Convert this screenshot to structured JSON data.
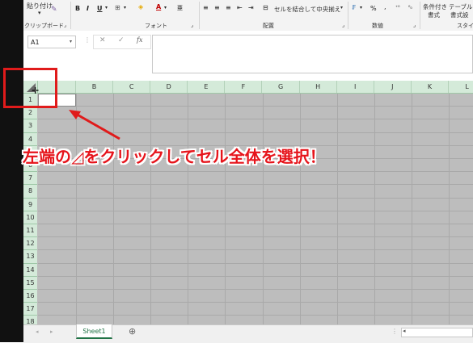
{
  "ribbon": {
    "paste_label": "貼り付け",
    "bold": "B",
    "italic": "I",
    "underline": "U",
    "merge_center_label": "セルを結合して中央揃え",
    "percent": "%",
    "comma": ",",
    "conditional_format_line1": "条件付き",
    "conditional_format_line2": "書式",
    "table_format_line1": "テーブル",
    "table_format_line2": "書式設",
    "groups": {
      "clipboard": "クリップボード",
      "font": "フォント",
      "alignment": "配置",
      "number": "数値",
      "styles": "スタイ"
    }
  },
  "formula_bar": {
    "name_box": "A1",
    "fx": "fx"
  },
  "columns": [
    "B",
    "C",
    "D",
    "E",
    "F",
    "G",
    "H",
    "I",
    "J",
    "K",
    "L"
  ],
  "rows": [
    "1",
    "2",
    "3",
    "4",
    "5",
    "6",
    "7",
    "8",
    "9",
    "10",
    "11",
    "12",
    "13",
    "14",
    "15",
    "16",
    "17",
    "18"
  ],
  "sheet_tabs": {
    "sheet1": "Sheet1",
    "add": "⊕"
  },
  "annotation": "左端の◿をクリックしてセル全体を選択！",
  "colors": {
    "accent": "#217346",
    "highlight_red": "#e01b1b",
    "selection_gray": "#bdbdbd"
  }
}
